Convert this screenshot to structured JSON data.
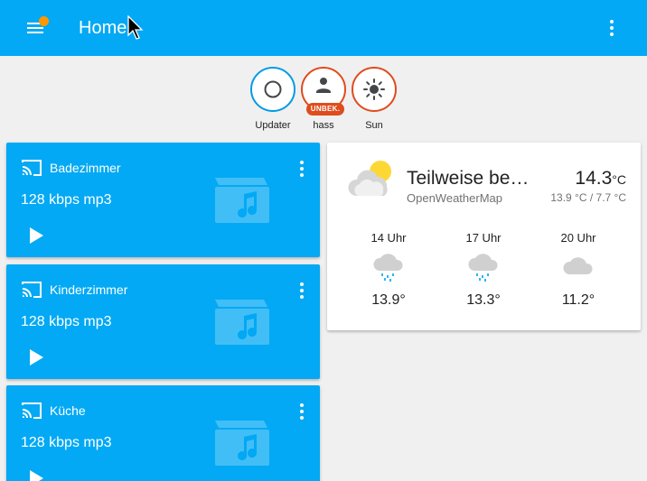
{
  "header": {
    "title": "Home",
    "accent": "#03a9f4",
    "notification_dot": "#ff9800"
  },
  "badges": [
    {
      "label": "Updater",
      "icon": "circle-outline-icon",
      "ring": "#039be5"
    },
    {
      "label": "hass",
      "tag": "UNBEK.",
      "icon": "person-icon",
      "ring": "#df4c1e"
    },
    {
      "label": "Sun",
      "icon": "sun-icon",
      "ring": "#df4c1e"
    }
  ],
  "media": [
    {
      "name": "Badezimmer",
      "status": "128 kbps mp3"
    },
    {
      "name": "Kinderzimmer",
      "status": "128 kbps mp3"
    },
    {
      "name": "Küche",
      "status": "128 kbps mp3"
    }
  ],
  "weather": {
    "state": "Teilweise bewölkt",
    "source": "OpenWeatherMap",
    "temperature": "14.3",
    "unit": "°C",
    "range": "13.9 °C / 7.7 °C",
    "icon": "partly-cloudy-icon",
    "forecast": [
      {
        "time": "14 Uhr",
        "temp": "13.9°",
        "icon": "rainy-cloud-icon"
      },
      {
        "time": "17 Uhr",
        "temp": "13.3°",
        "icon": "rainy-cloud-icon"
      },
      {
        "time": "20 Uhr",
        "temp": "11.2°",
        "icon": "cloud-icon"
      }
    ]
  }
}
